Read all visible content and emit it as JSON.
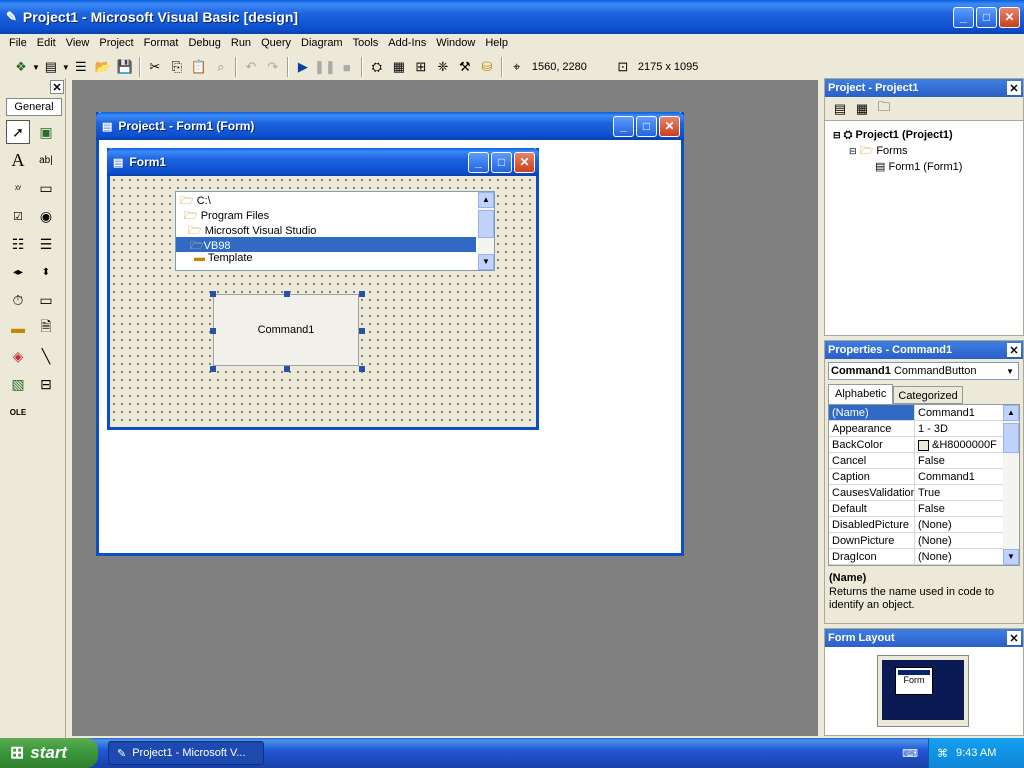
{
  "window": {
    "title": "Project1 - Microsoft Visual Basic [design]"
  },
  "menu": [
    "File",
    "Edit",
    "View",
    "Project",
    "Format",
    "Debug",
    "Run",
    "Query",
    "Diagram",
    "Tools",
    "Add-Ins",
    "Window",
    "Help"
  ],
  "toolbar": {
    "position": "1560, 2280",
    "size": "2175 x 1095"
  },
  "toolbox": {
    "title": "General"
  },
  "form_window": {
    "title": "Project1 - Form1 (Form)"
  },
  "form": {
    "title": "Form1",
    "dirlist": [
      "C:\\",
      "Program Files",
      "Microsoft Visual Studio",
      "VB98",
      "Template"
    ],
    "dirlist_selected": "VB98",
    "button": "Command1"
  },
  "project": {
    "title": "Project - Project1",
    "root": "Project1 (Project1)",
    "folder": "Forms",
    "item": "Form1 (Form1)"
  },
  "properties": {
    "title": "Properties - Command1",
    "object": "Command1",
    "object_type": "CommandButton",
    "tab_alpha": "Alphabetic",
    "tab_cat": "Categorized",
    "rows": [
      {
        "k": "(Name)",
        "v": "Command1"
      },
      {
        "k": "Appearance",
        "v": "1 - 3D"
      },
      {
        "k": "BackColor",
        "v": "&H8000000F"
      },
      {
        "k": "Cancel",
        "v": "False"
      },
      {
        "k": "Caption",
        "v": "Command1"
      },
      {
        "k": "CausesValidation",
        "v": "True"
      },
      {
        "k": "Default",
        "v": "False"
      },
      {
        "k": "DisabledPicture",
        "v": "(None)"
      },
      {
        "k": "DownPicture",
        "v": "(None)"
      },
      {
        "k": "DragIcon",
        "v": "(None)"
      }
    ],
    "desc_title": "(Name)",
    "desc_text": "Returns the name used in code to identify an object."
  },
  "form_layout": {
    "title": "Form Layout",
    "label": "Form"
  },
  "taskbar": {
    "start": "start",
    "task": "Project1 - Microsoft V...",
    "clock": "9:43 AM"
  },
  "colors": {
    "xp_blue": "#0b4ecb",
    "selection": "#316ac5",
    "desktop_gray": "#808080",
    "start_green": "#3c9a3c"
  }
}
